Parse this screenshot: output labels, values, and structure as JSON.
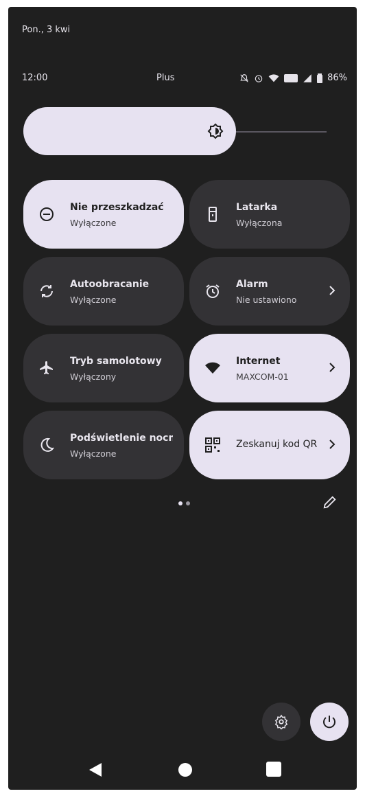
{
  "header": {
    "date": "Pon., 3 kwi"
  },
  "status_bar": {
    "time": "12:00",
    "carrier": "Plus",
    "battery": "86%"
  },
  "brightness": {
    "level": 0.62
  },
  "tiles": [
    {
      "title": "Nie przeszkadzać",
      "subtitle": "Wyłączone",
      "state": "on",
      "icon": "minus-circle-icon"
    },
    {
      "title": "Latarka",
      "subtitle": "Wyłączona",
      "state": "off",
      "icon": "flashlight-icon"
    },
    {
      "title": "Autoobracanie",
      "subtitle": "Wyłączone",
      "state": "off",
      "icon": "rotate-icon"
    },
    {
      "title": "Alarm",
      "subtitle": "Nie ustawiono",
      "state": "off",
      "icon": "alarm-icon"
    },
    {
      "title": "Tryb samolotowy",
      "subtitle": "Wyłączony",
      "state": "off",
      "icon": "airplane-icon"
    },
    {
      "title": "Internet",
      "subtitle": "MAXCOM-01",
      "state": "on",
      "icon": "wifi-icon"
    },
    {
      "title": "Podświetlenie nocne",
      "subtitle": "Wyłączone",
      "state": "off",
      "icon": "moon-icon"
    },
    {
      "title": "Zeskanuj kod QR",
      "subtitle": "",
      "state": "on",
      "icon": "qr-code-icon"
    }
  ],
  "pager": {
    "pages": 2,
    "current": 1
  },
  "colors": {
    "tile_on": "#e7e2f1",
    "tile_off": "#333235",
    "background": "#1f1f1f"
  }
}
